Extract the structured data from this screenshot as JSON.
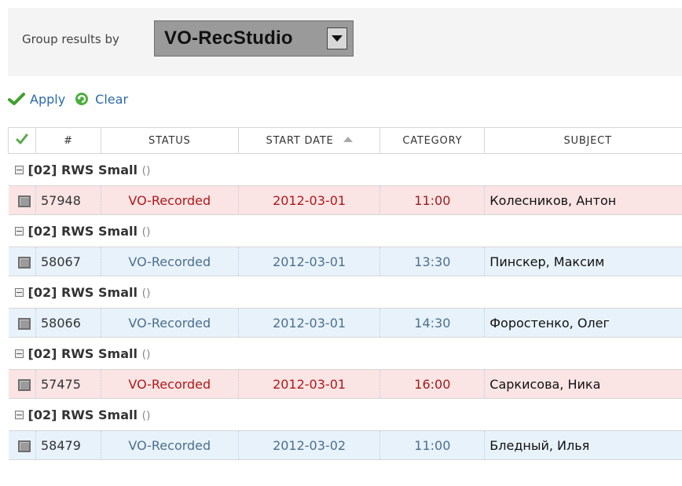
{
  "group_by": {
    "label": "Group results by",
    "selected": "VO-RecStudio"
  },
  "actions": {
    "apply": "Apply",
    "clear": "Clear"
  },
  "columns": {
    "num": "#",
    "status": "STATUS",
    "start_date": "START DATE",
    "category": "CATEGORY",
    "subject": "SUBJECT"
  },
  "groups": [
    {
      "label": "[02] RWS Small",
      "paren": "()",
      "row": {
        "num": "57948",
        "status": "VO-Recorded",
        "date": "2012-03-01",
        "category": "11:00",
        "subject": "Колесников, Антон",
        "tone": "pink"
      }
    },
    {
      "label": "[02] RWS Small",
      "paren": "()",
      "row": {
        "num": "58067",
        "status": "VO-Recorded",
        "date": "2012-03-01",
        "category": "13:30",
        "subject": "Пинскер, Максим",
        "tone": "blue"
      }
    },
    {
      "label": "[02] RWS Small",
      "paren": "()",
      "row": {
        "num": "58066",
        "status": "VO-Recorded",
        "date": "2012-03-01",
        "category": "14:30",
        "subject": "Форостенко, Олег",
        "tone": "blue"
      }
    },
    {
      "label": "[02] RWS Small",
      "paren": "()",
      "row": {
        "num": "57475",
        "status": "VO-Recorded",
        "date": "2012-03-01",
        "category": "16:00",
        "subject": "Саркисова, Ника",
        "tone": "pink"
      }
    },
    {
      "label": "[02] RWS Small",
      "paren": "()",
      "row": {
        "num": "58479",
        "status": "VO-Recorded",
        "date": "2012-03-02",
        "category": "11:00",
        "subject": "Бледный, Илья",
        "tone": "blue"
      }
    }
  ],
  "colors": {
    "pink_row": "#fbe4e4",
    "blue_row": "#e8f2fb",
    "link": "#2a6aa8",
    "status_red": "#b0181b"
  },
  "icons": {
    "apply": "green-check-icon",
    "clear": "green-refresh-icon",
    "header_check": "green-check-icon",
    "sort": "sort-ascending-icon",
    "collapse": "collapse-minus-icon",
    "select": "dropdown-arrow-icon"
  }
}
